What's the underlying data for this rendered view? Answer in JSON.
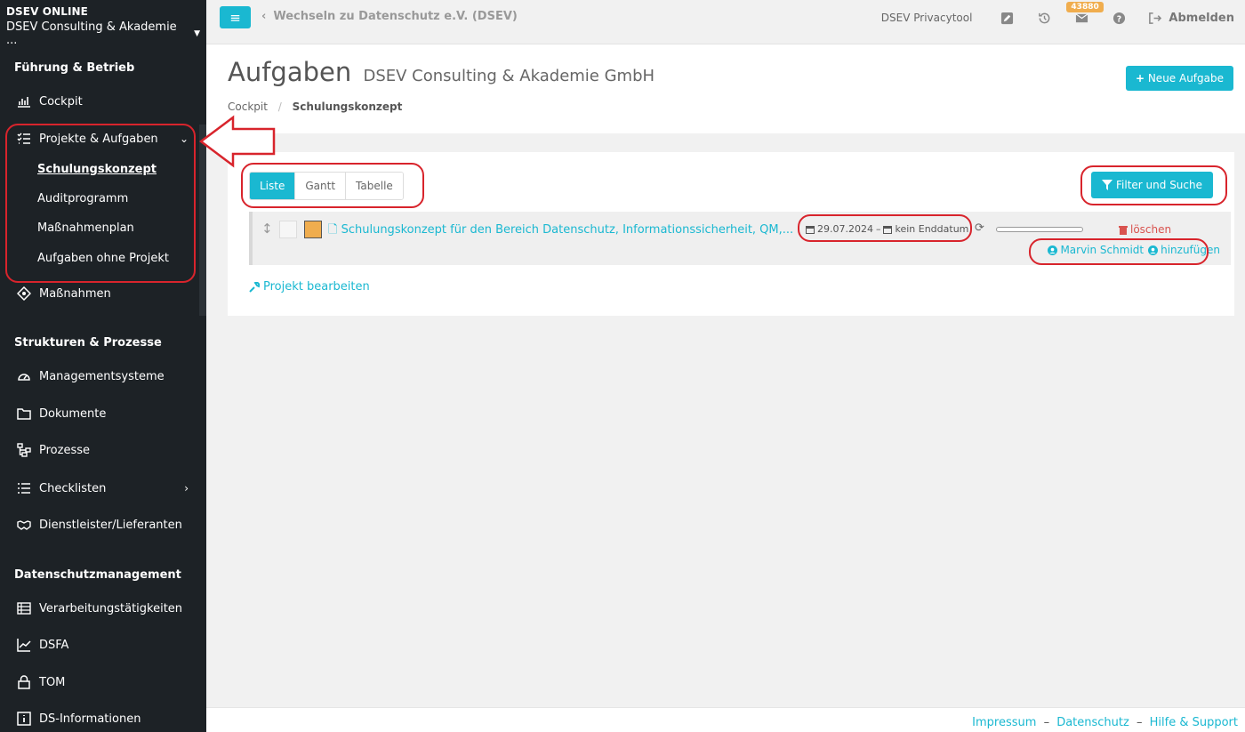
{
  "sidebar": {
    "brand_title": "DSEV ONLINE",
    "brand_org": "DSEV Consulting & Akademie ...",
    "sections": {
      "fuehrung": "Führung & Betrieb",
      "strukturen": "Strukturen & Prozesse",
      "datenschutz": "Datenschutzmanagement"
    },
    "items": {
      "cockpit": "Cockpit",
      "projekte": "Projekte & Aufgaben",
      "massnahmen": "Maßnahmen",
      "managementsysteme": "Managementsysteme",
      "dokumente": "Dokumente",
      "prozesse": "Prozesse",
      "checklisten": "Checklisten",
      "dienstleister": "Dienstleister/Lieferanten",
      "verarbeitung": "Verarbeitungstätigkeiten",
      "dsfa": "DSFA",
      "tom": "TOM",
      "dsinfo": "DS-Informationen"
    },
    "subitems": {
      "schulung": "Schulungskonzept",
      "audit": "Auditprogramm",
      "massnahmenplan": "Maßnahmenplan",
      "ohne_projekt": "Aufgaben ohne Projekt"
    }
  },
  "topbar": {
    "switch_link": "Wechseln zu Datenschutz e.V. (DSEV)",
    "tool_name": "DSEV Privacytool",
    "badge_count": "43880",
    "logout": "Abmelden"
  },
  "header": {
    "title": "Aufgaben",
    "subtitle": "DSEV Consulting & Akademie GmbH",
    "breadcrumb_root": "Cockpit",
    "breadcrumb_current": "Schulungskonzept",
    "new_task": "Neue Aufgabe"
  },
  "tabs": [
    "Liste",
    "Gantt",
    "Tabelle"
  ],
  "filter_button": "Filter und Suche",
  "task": {
    "title": "Schulungskonzept für den Bereich Datenschutz, Informationssicherheit, QM,...",
    "start_date": "29.07.2024",
    "date_sep": "–",
    "end_date": "kein Enddatum",
    "progress": 0,
    "delete": "löschen",
    "assignee": "Marvin Schmidt",
    "add_assignee": "hinzufügen"
  },
  "edit_project": "Projekt bearbeiten",
  "footer": {
    "impressum": "Impressum",
    "datenschutz": "Datenschutz",
    "hilfe": "Hilfe & Support",
    "sep": "–"
  },
  "colors": {
    "accent": "#1ab8d1",
    "sidebar_bg": "#1d2226",
    "task_color": "#f0ad4e",
    "danger": "#d9534f",
    "annotation": "#d8242c"
  }
}
